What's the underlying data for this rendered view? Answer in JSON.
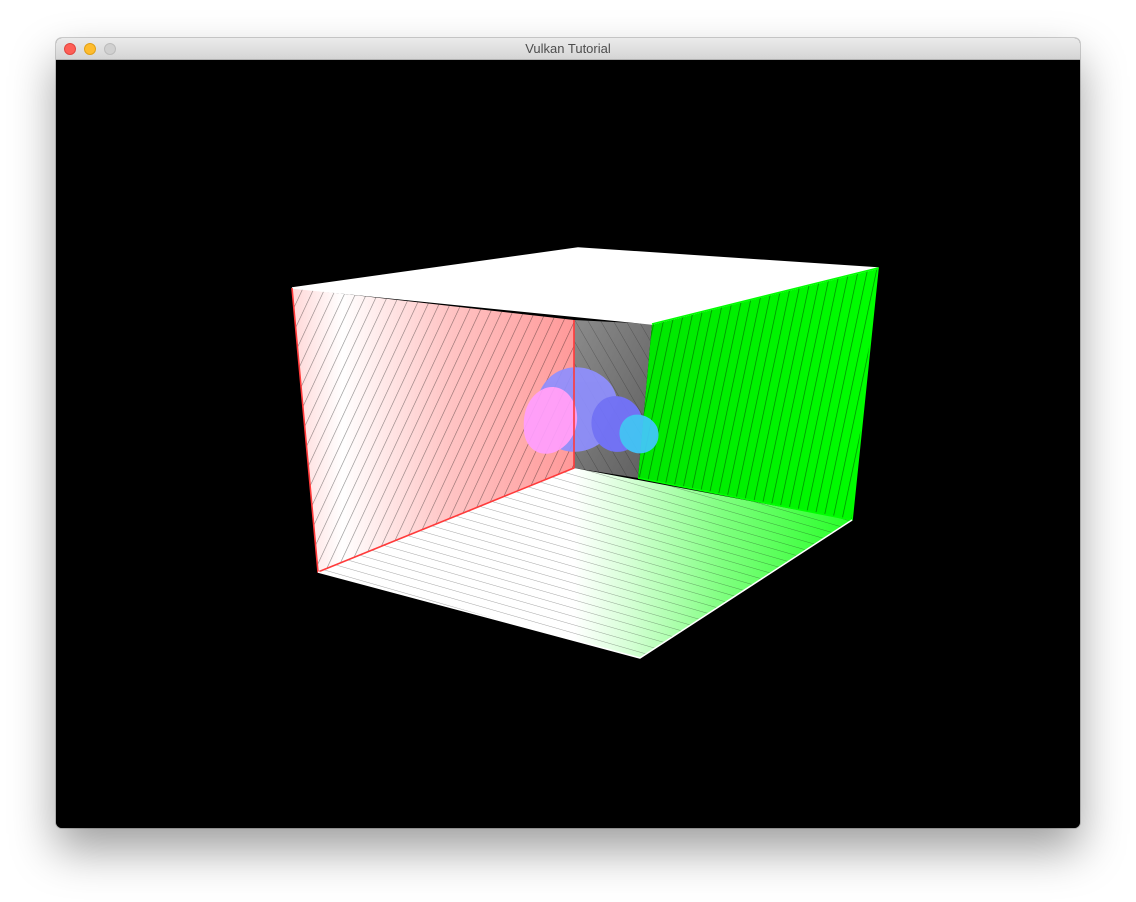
{
  "window": {
    "title": "Vulkan Tutorial",
    "controls": [
      "close",
      "minimize",
      "zoom"
    ]
  },
  "scene": {
    "background_color": "#000000",
    "object": "open-box-room",
    "faces": {
      "ceiling": "#ffffff",
      "left_wall": "#ffb3b3",
      "right_wall": "#00ff00",
      "floor": "#ffffff",
      "back_wall": "#7a7a7a"
    },
    "center_model_colors": [
      "#8f8fff",
      "#ff9fff",
      "#43c7ff"
    ]
  }
}
